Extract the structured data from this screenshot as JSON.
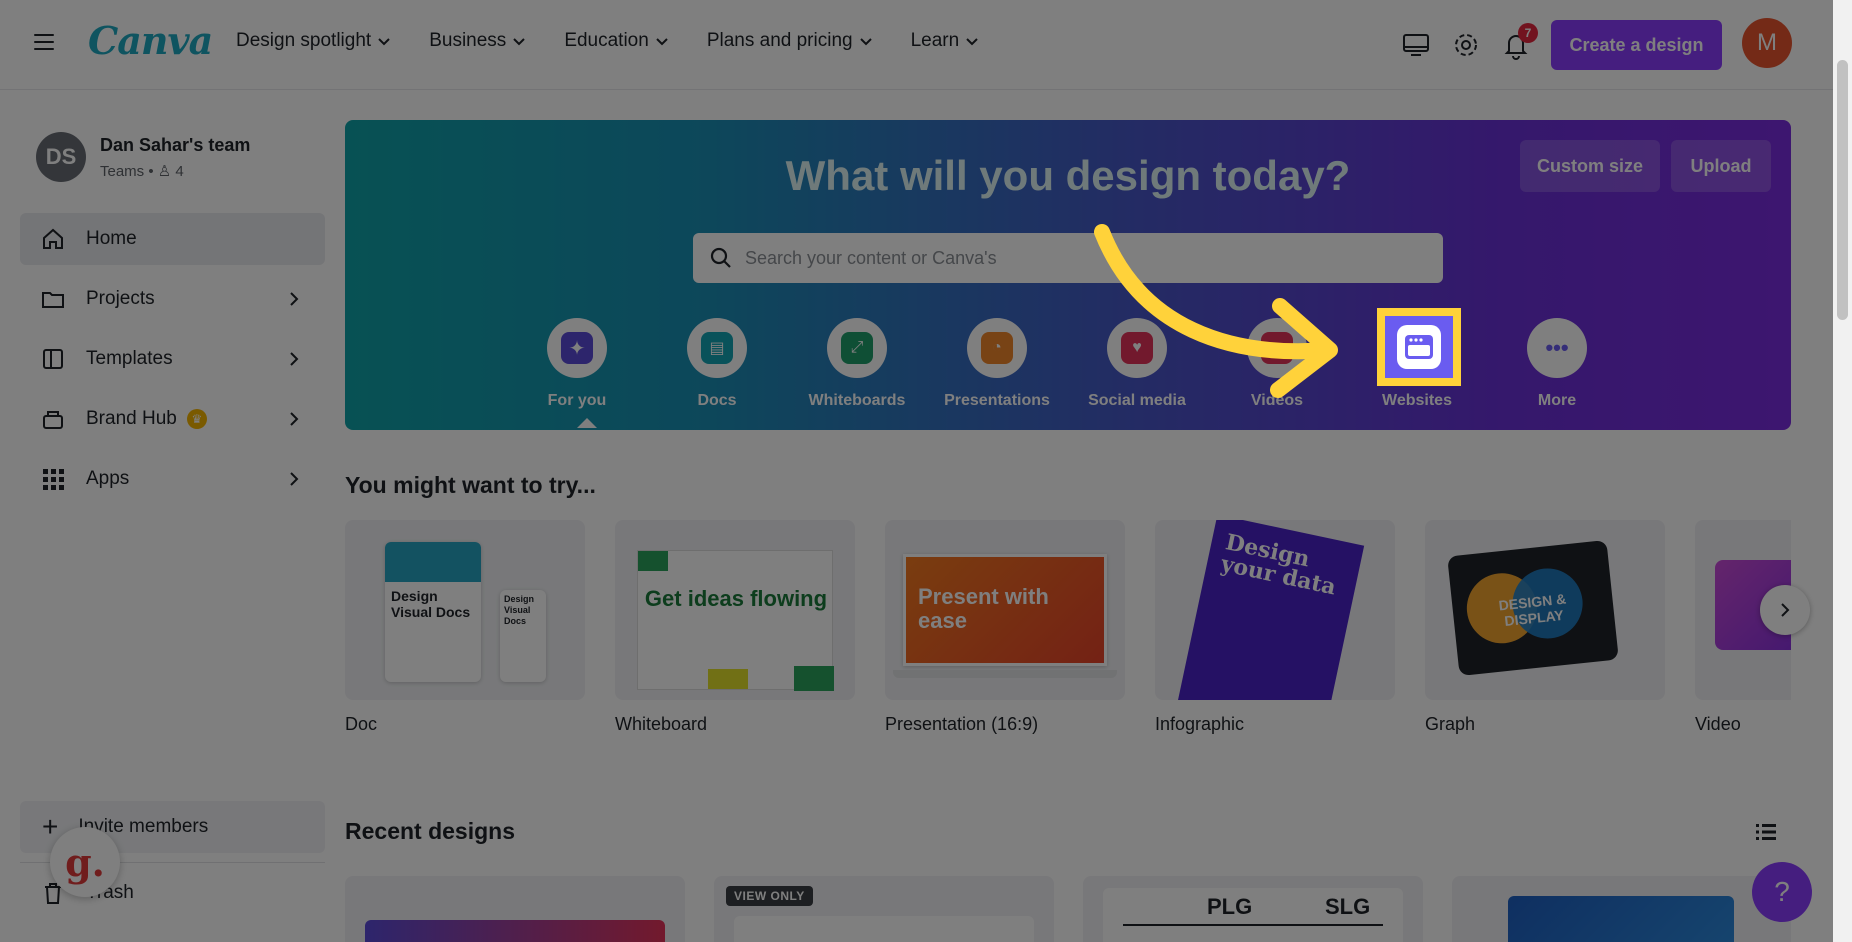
{
  "logo": "Canva",
  "nav": {
    "links": [
      "Design spotlight",
      "Business",
      "Education",
      "Plans and pricing",
      "Learn"
    ],
    "notification_count": "7",
    "create_label": "Create a design",
    "avatar_initial": "M"
  },
  "sidebar": {
    "team_initials": "DS",
    "team_name": "Dan Sahar's team",
    "team_meta": "Teams • ♙ 4",
    "items": [
      {
        "label": "Home",
        "icon": "home-icon",
        "active": true
      },
      {
        "label": "Projects",
        "icon": "folder-icon"
      },
      {
        "label": "Templates",
        "icon": "templates-icon"
      },
      {
        "label": "Brand Hub",
        "icon": "brand-hub-icon"
      },
      {
        "label": "Apps",
        "icon": "apps-grid-icon"
      }
    ],
    "invite_label": "Invite members",
    "trash_label": "Trash",
    "extension_badge": "g."
  },
  "hero": {
    "title": "What will you design today?",
    "custom_size": "Custom size",
    "upload": "Upload",
    "search_placeholder": "Search your content or Canva's",
    "categories": [
      {
        "label": "For you",
        "color": "#5b4bd9",
        "icon": "sparkle-icon"
      },
      {
        "label": "Docs",
        "color": "#13a5b4",
        "icon": "docs-icon"
      },
      {
        "label": "Whiteboards",
        "color": "#1e9e6b",
        "icon": "whiteboard-icon"
      },
      {
        "label": "Presentations",
        "color": "#f0862b",
        "icon": "presentation-icon"
      },
      {
        "label": "Social media",
        "color": "#e5335a",
        "icon": "heart-icon"
      },
      {
        "label": "Videos",
        "color": "#e5335a",
        "icon": "video-icon"
      },
      {
        "label": "Websites",
        "color": "#6a5cf0",
        "icon": "website-icon"
      },
      {
        "label": "More",
        "color": "#6a5cf0",
        "icon": "more-icon"
      }
    ]
  },
  "suggestions": {
    "title": "You might want to try...",
    "cards": [
      "Doc",
      "Whiteboard",
      "Presentation (16:9)",
      "Infographic",
      "Graph",
      "Video"
    ],
    "thumb_text": {
      "doc": "Design Visual Docs",
      "doc_small": "Design Visual Docs",
      "whiteboard": "Get ideas flowing",
      "presentation": "Present with ease",
      "infographic": "Design your data",
      "graph": "DESIGN & DISPLAY"
    }
  },
  "recent": {
    "title": "Recent designs",
    "view_only": "VIEW ONLY",
    "plg": "PLG",
    "slg": "SLG"
  },
  "help_label": "?"
}
